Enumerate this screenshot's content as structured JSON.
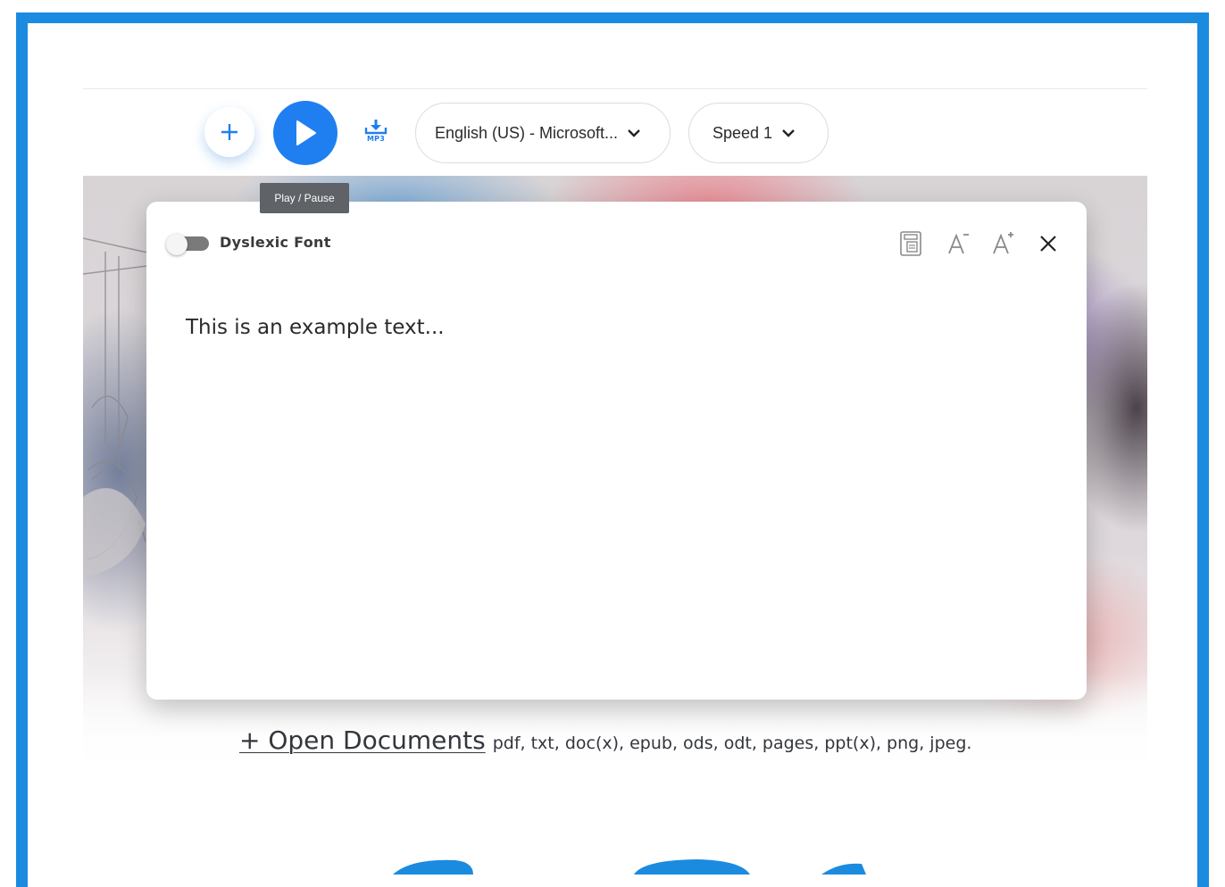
{
  "toolbar": {
    "add_icon": "plus-icon",
    "play_icon": "play-icon",
    "mp3_label": "MP3",
    "voice_select": "English (US) - Microsoft...",
    "speed_select": "Speed 1",
    "tooltip": "Play / Pause"
  },
  "panel": {
    "dyslexic_font_label": "Dyslexic Font",
    "dyslexic_font_enabled": false,
    "text": "This is an example text...",
    "icons": [
      "reader-mode-icon",
      "decrease-font-icon",
      "increase-font-icon",
      "close-icon"
    ]
  },
  "documents": {
    "open_label": "+ Open Documents",
    "formats": "pdf, txt, doc(x), epub, ods, odt, pages, ppt(x), png, jpeg."
  },
  "colors": {
    "accent": "#1f7ff0",
    "frame": "#1b8be0"
  }
}
